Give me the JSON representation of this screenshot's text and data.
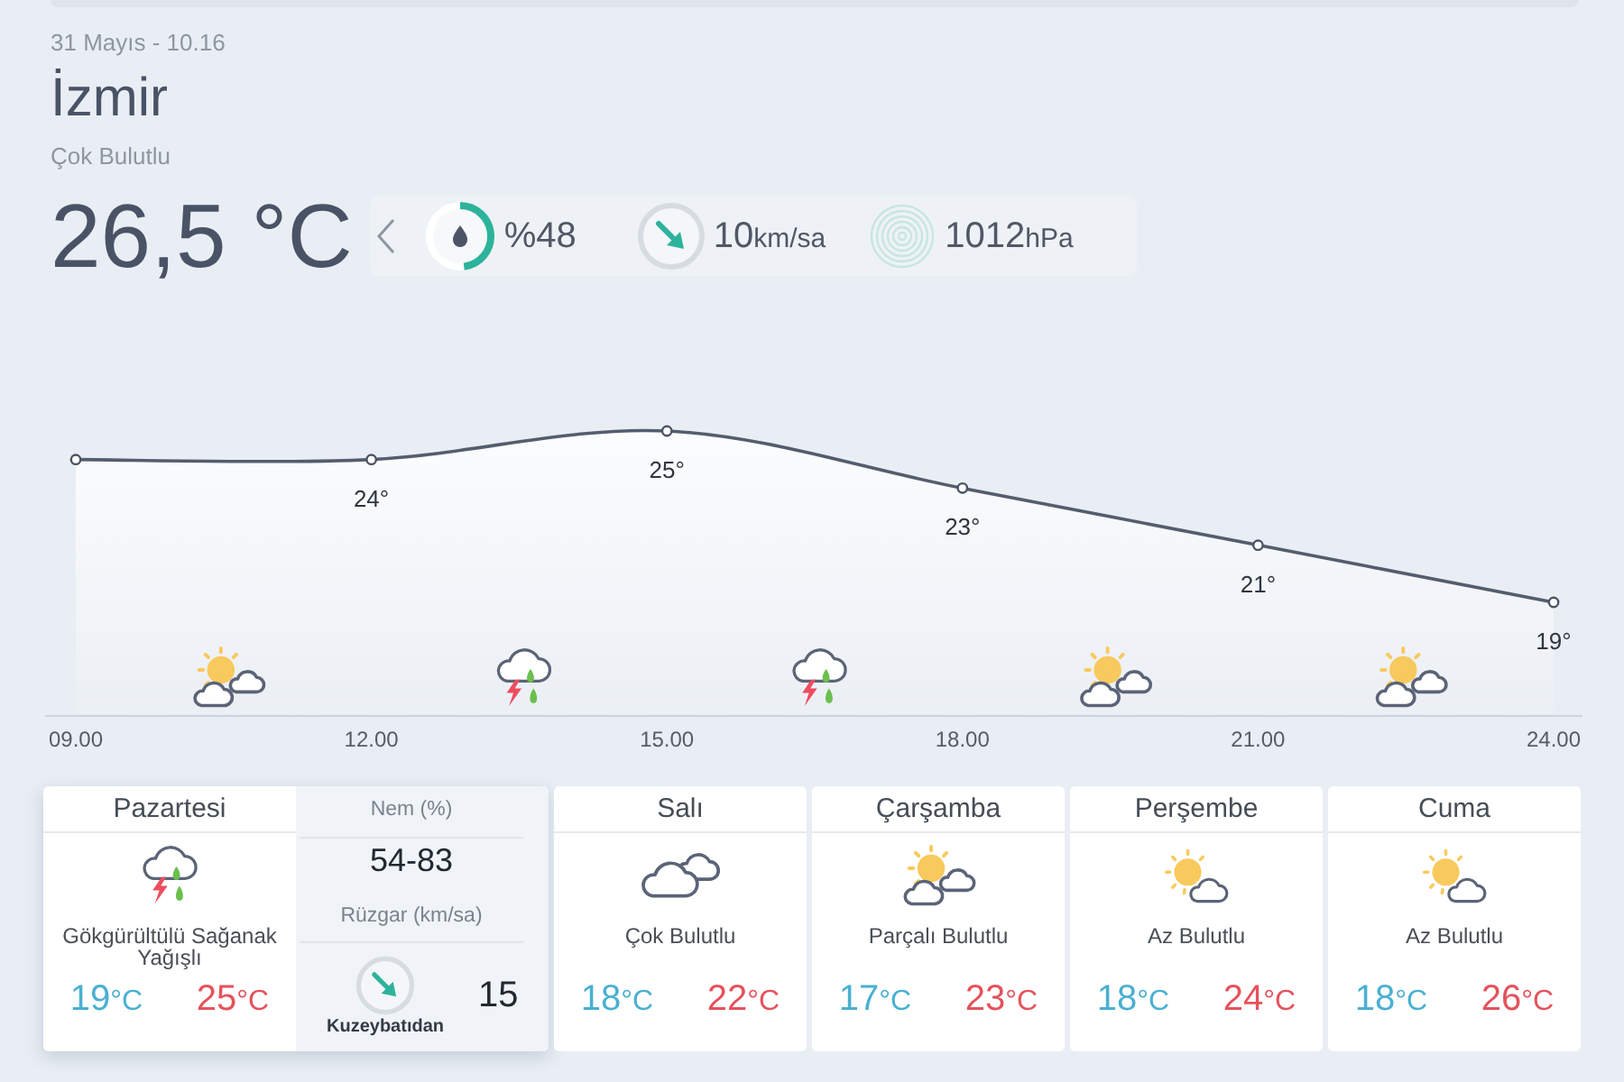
{
  "header": {
    "date": "31 Mayıs - 10.16",
    "city": "İzmir",
    "condition": "Çok Bulutlu",
    "temperature": "26,5 °C"
  },
  "current": {
    "humidity": {
      "value": "%48",
      "level": 0.48
    },
    "wind": {
      "value": "10",
      "unit": "km/sa"
    },
    "pressure": {
      "value": "1012",
      "unit": "hPa"
    }
  },
  "hourly": {
    "chart_data": {
      "type": "area",
      "categories": [
        "09.00",
        "12.00",
        "15.00",
        "18.00",
        "21.00",
        "24.00"
      ],
      "values": [
        24,
        24,
        25,
        23,
        21,
        19
      ],
      "value_labels": [
        null,
        "24°",
        "25°",
        "23°",
        "21°",
        "19°"
      ]
    },
    "icons": [
      {
        "kind": "partly-cloudy"
      },
      {
        "kind": "thunderstorm"
      },
      {
        "kind": "thunderstorm"
      },
      {
        "kind": "partly-cloudy"
      },
      {
        "kind": "partly-cloudy"
      }
    ]
  },
  "days": [
    {
      "name": "Pazartesi",
      "kind": "thunderstorm",
      "condition": "Gökgürültülü Sağanak Yağışlı",
      "low": {
        "value": "19",
        "unit": "°C"
      },
      "high": {
        "value": "25",
        "unit": "°C"
      },
      "selected": true,
      "details": {
        "humidity_label": "Nem (%)",
        "humidity": "54-83",
        "wind_label": "Rüzgar (km/sa)",
        "wind_direction": "Kuzeybatıdan",
        "wind": "15"
      }
    },
    {
      "name": "Salı",
      "kind": "cloudy",
      "condition": "Çok Bulutlu",
      "low": {
        "value": "18",
        "unit": "°C"
      },
      "high": {
        "value": "22",
        "unit": "°C"
      },
      "selected": false
    },
    {
      "name": "Çarşamba",
      "kind": "partly-cloudy",
      "condition": "Parçalı Bulutlu",
      "low": {
        "value": "17",
        "unit": "°C"
      },
      "high": {
        "value": "23",
        "unit": "°C"
      },
      "selected": false
    },
    {
      "name": "Perşembe",
      "kind": "mostly-sunny",
      "condition": "Az Bulutlu",
      "low": {
        "value": "18",
        "unit": "°C"
      },
      "high": {
        "value": "24",
        "unit": "°C"
      },
      "selected": false
    },
    {
      "name": "Cuma",
      "kind": "mostly-sunny",
      "condition": "Az Bulutlu",
      "low": {
        "value": "18",
        "unit": "°C"
      },
      "high": {
        "value": "26",
        "unit": "°C"
      },
      "selected": false
    }
  ]
}
